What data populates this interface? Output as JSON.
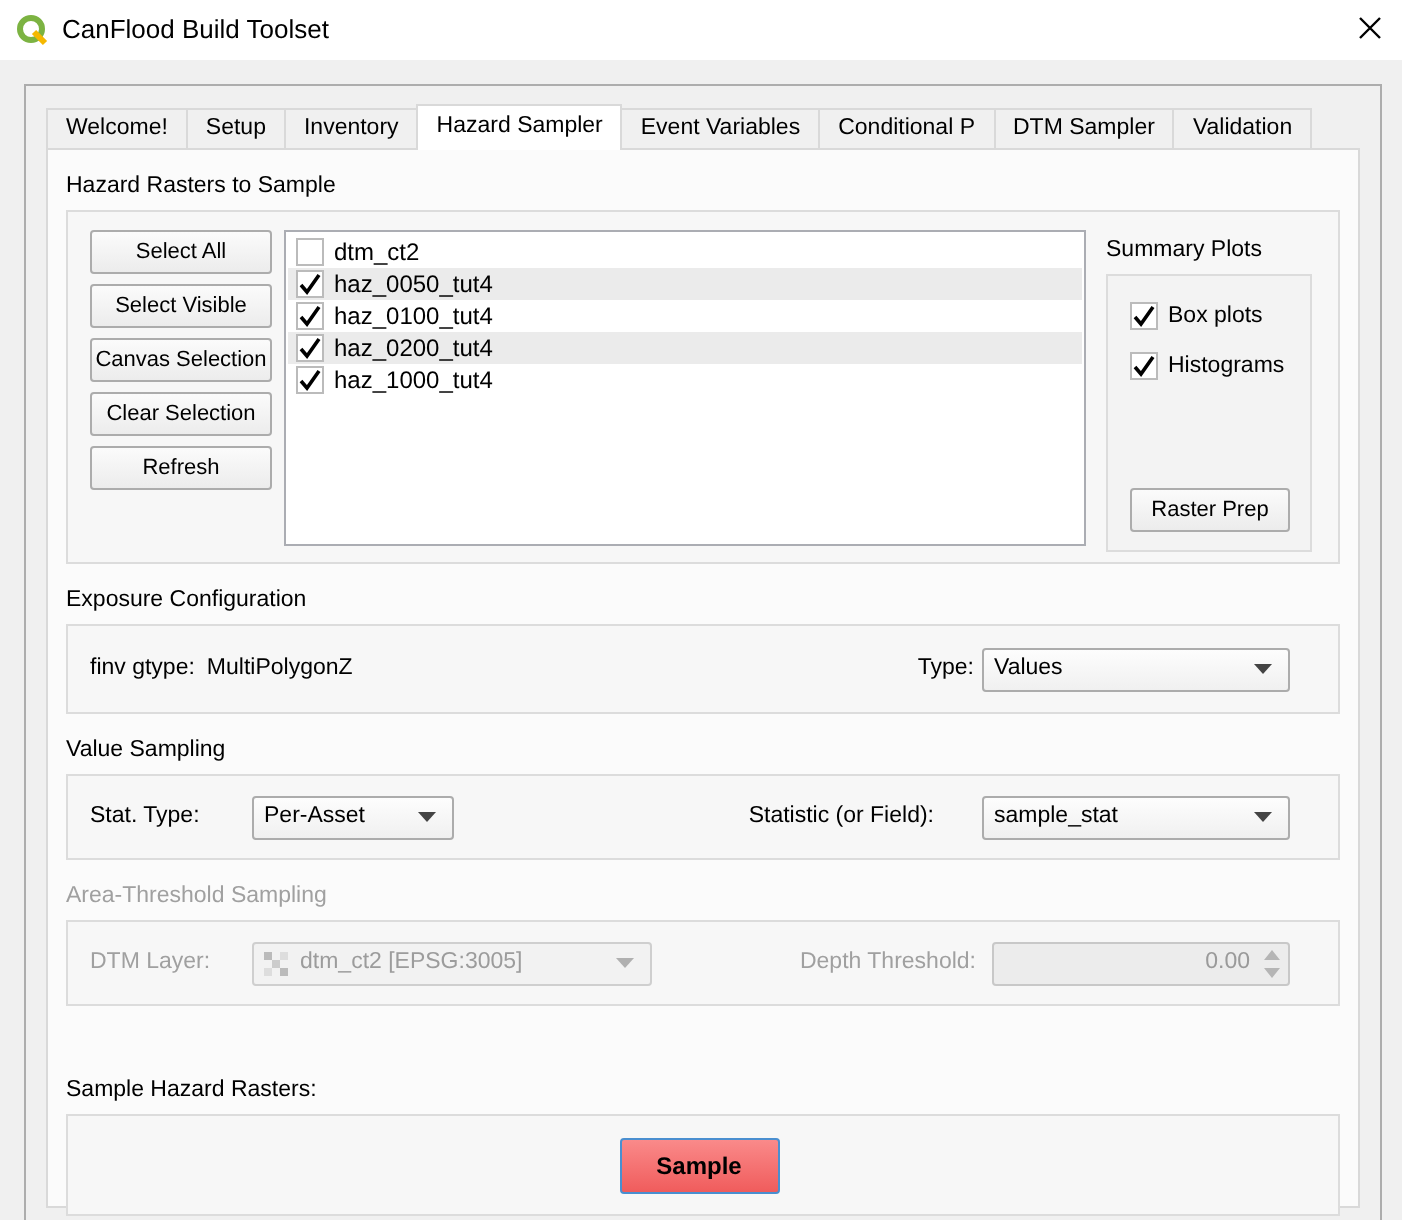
{
  "window": {
    "title": "CanFlood Build Toolset"
  },
  "tabs": [
    {
      "label": "Welcome!",
      "selected": false
    },
    {
      "label": "Setup",
      "selected": false
    },
    {
      "label": "Inventory",
      "selected": false
    },
    {
      "label": "Hazard Sampler",
      "selected": true
    },
    {
      "label": "Event Variables",
      "selected": false
    },
    {
      "label": "Conditional P",
      "selected": false
    },
    {
      "label": "DTM Sampler",
      "selected": false
    },
    {
      "label": "Validation",
      "selected": false
    }
  ],
  "hazard_rasters": {
    "title": "Hazard Rasters to Sample",
    "buttons": [
      "Select All",
      "Select Visible",
      "Canvas Selection",
      "Clear Selection",
      "Refresh"
    ],
    "layers": [
      {
        "name": "dtm_ct2",
        "checked": false
      },
      {
        "name": "haz_0050_tut4",
        "checked": true
      },
      {
        "name": "haz_0100_tut4",
        "checked": true
      },
      {
        "name": "haz_0200_tut4",
        "checked": true
      },
      {
        "name": "haz_1000_tut4",
        "checked": true
      }
    ]
  },
  "summary_plots": {
    "title": "Summary Plots",
    "options": [
      {
        "label": "Box plots",
        "checked": true
      },
      {
        "label": "Histograms",
        "checked": true
      }
    ],
    "button": "Raster Prep"
  },
  "exposure": {
    "title": "Exposure Configuration",
    "gtype_label": "finv gtype:",
    "gtype_value": "MultiPolygonZ",
    "type_label": "Type:",
    "type_value": "Values"
  },
  "value_sampling": {
    "title": "Value Sampling",
    "stat_type_label": "Stat. Type:",
    "stat_type_value": "Per-Asset",
    "statistic_label": "Statistic (or Field):",
    "statistic_value": "sample_stat"
  },
  "area_threshold": {
    "title": "Area-Threshold Sampling",
    "disabled": true,
    "dtm_label": "DTM Layer:",
    "dtm_value": "dtm_ct2 [EPSG:3005]",
    "depth_label": "Depth Threshold:",
    "depth_value": "0.00"
  },
  "run": {
    "title": "Sample Hazard Rasters:",
    "button": "Sample"
  }
}
